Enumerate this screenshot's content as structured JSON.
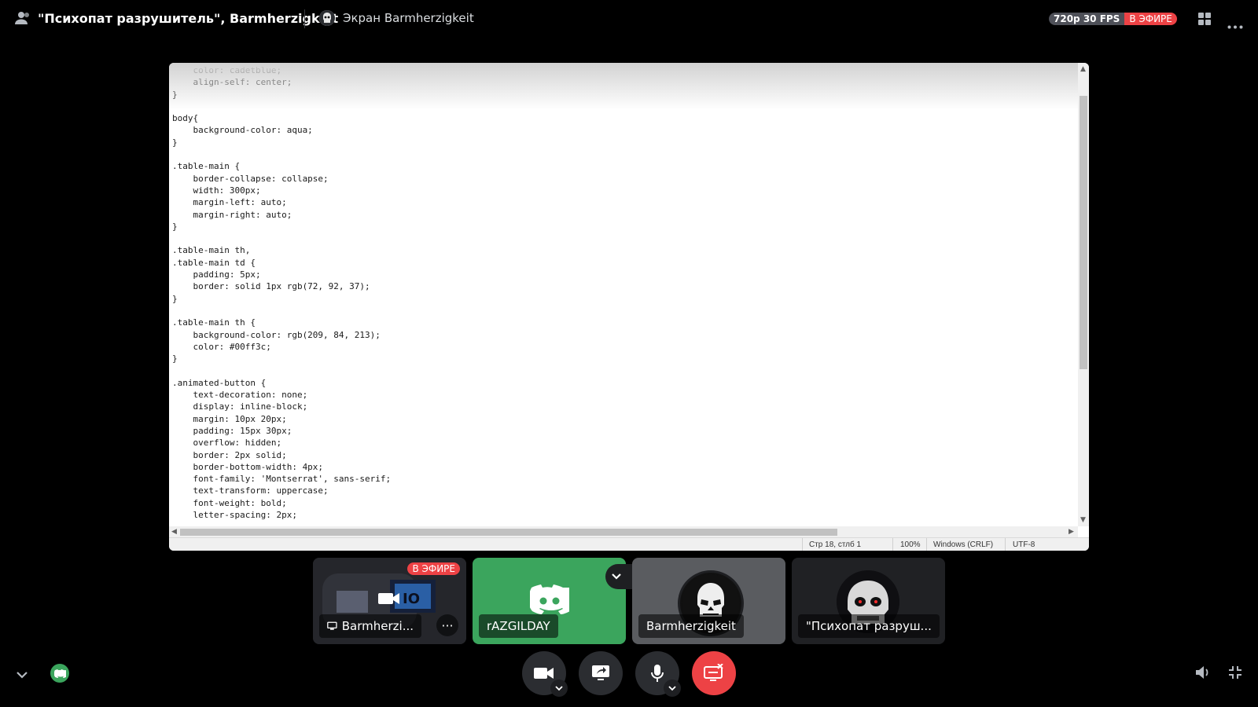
{
  "header": {
    "title": "\"Психопат разрушитель\", Barmherzigkeit",
    "screen_label": "Экран Barmherzigkeit",
    "quality": "720p 30 FPS",
    "live": "В ЭФИРЕ"
  },
  "editor": {
    "code_lines": [
      "    color: cadetblue;",
      "    align-self: center;",
      "}",
      "",
      "body{",
      "    background-color: aqua;",
      "}",
      "",
      ".table-main {",
      "    border-collapse: collapse;",
      "    width: 300px;",
      "    margin-left: auto;",
      "    margin-right: auto;",
      "}",
      "",
      ".table-main th,",
      ".table-main td {",
      "    padding: 5px;",
      "    border: solid 1px rgb(72, 92, 37);",
      "}",
      "",
      ".table-main th {",
      "    background-color: rgb(209, 84, 213);",
      "    color: #00ff3c;",
      "}",
      "",
      ".animated-button {",
      "    text-decoration: none;",
      "    display: inline-block;",
      "    margin: 10px 20px;",
      "    padding: 15px 30px;",
      "    overflow: hidden;",
      "    border: 2px solid;",
      "    border-bottom-width: 4px;",
      "    font-family: 'Montserrat', sans-serif;",
      "    text-transform: uppercase;",
      "    font-weight: bold;",
      "    letter-spacing: 2px;"
    ],
    "status": {
      "position": "Стр 18, стлб 1",
      "zoom": "100%",
      "line_ending": "Windows (CRLF)",
      "encoding": "UTF-8"
    }
  },
  "tiles": [
    {
      "name": "Barmherzi...",
      "badge": "В ЭФИРЕ"
    },
    {
      "name": "rAZGILDAY"
    },
    {
      "name": "Barmherzigkeit"
    },
    {
      "name": "\"Психопат разруш..."
    }
  ],
  "icons": {
    "people": "people-icon",
    "grid": "grid-view-icon",
    "more": "more-icon",
    "camera": "camera-icon",
    "share": "screen-share-icon",
    "mic": "microphone-icon",
    "leave": "stop-stream-icon",
    "volume": "volume-icon",
    "exit_fullscreen": "exit-fullscreen-icon"
  },
  "colors": {
    "live": "#ed4245",
    "discord_green": "#3ba55d",
    "leave_red": "#ed4245"
  }
}
